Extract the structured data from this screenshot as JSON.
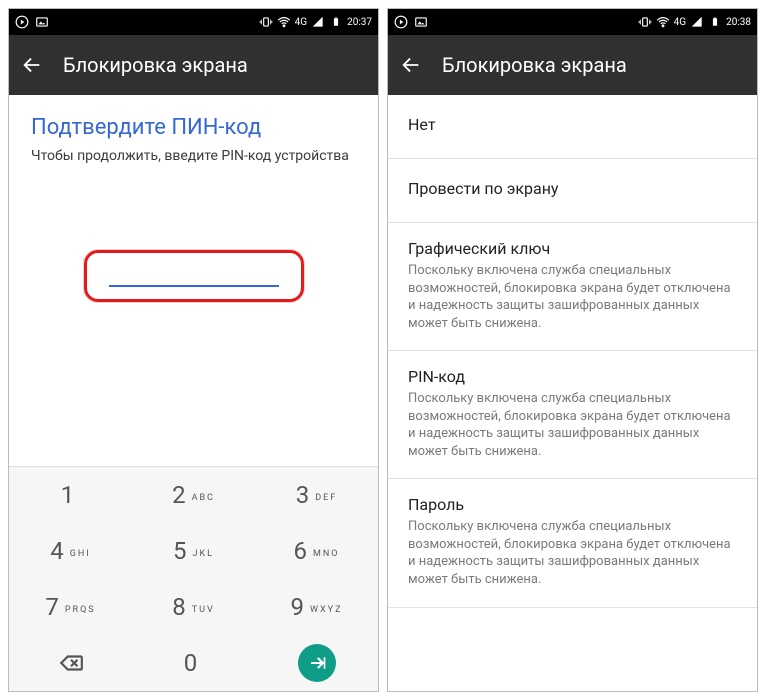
{
  "statusbar_left": {
    "time1": "20:37",
    "time2": "20:38",
    "net": "4G"
  },
  "appbar": {
    "title": "Блокировка экрана"
  },
  "pin": {
    "title": "Подтвердите ПИН-код",
    "subtitle": "Чтобы продолжить, введите PIN-код устройства"
  },
  "keypad": {
    "k1": {
      "num": "1",
      "sub": ""
    },
    "k2": {
      "num": "2",
      "sub": "ABC"
    },
    "k3": {
      "num": "3",
      "sub": "DEF"
    },
    "k4": {
      "num": "4",
      "sub": "GHI"
    },
    "k5": {
      "num": "5",
      "sub": "JKL"
    },
    "k6": {
      "num": "6",
      "sub": "MNO"
    },
    "k7": {
      "num": "7",
      "sub": "PRQS"
    },
    "k8": {
      "num": "8",
      "sub": "TUV"
    },
    "k9": {
      "num": "9",
      "sub": "WXYZ"
    },
    "k0": {
      "num": "0",
      "sub": ""
    }
  },
  "options": {
    "none": {
      "title": "Нет"
    },
    "swipe": {
      "title": "Провести по экрану"
    },
    "pattern": {
      "title": "Графический ключ",
      "desc": "Поскольку включена служба специальных возможностей, блокировка экрана будет отключена и надежность защиты зашифрованных данных может быть снижена."
    },
    "pin": {
      "title": "PIN-код",
      "desc": "Поскольку включена служба специальных возможностей, блокировка экрана будет отключена и надежность защиты зашифрованных данных может быть снижена."
    },
    "password": {
      "title": "Пароль",
      "desc": "Поскольку включена служба специальных возможностей, блокировка экрана будет отключена и надежность защиты зашифрованных данных может быть снижена."
    }
  }
}
